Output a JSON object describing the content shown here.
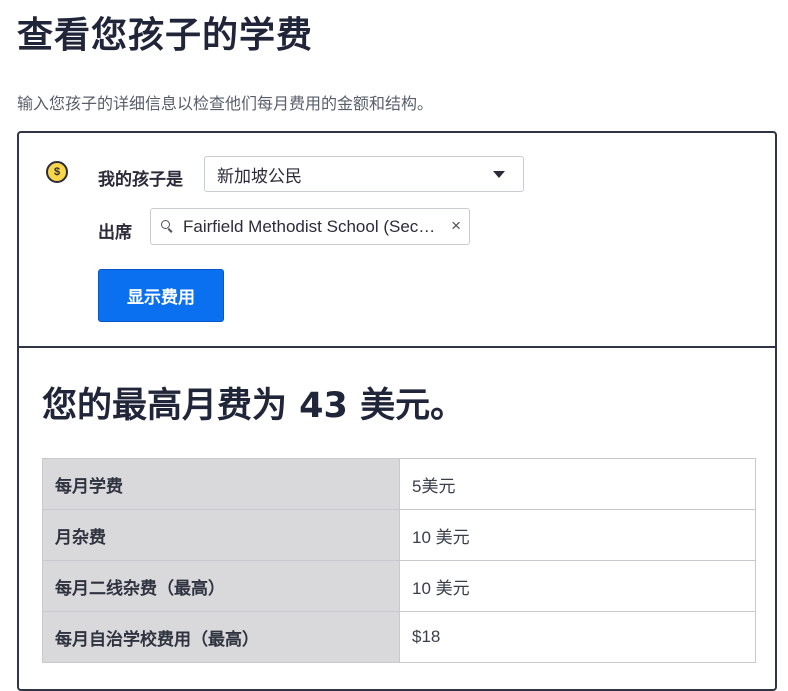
{
  "page": {
    "title": "查看您孩子的学费",
    "description": "输入您孩子的详细信息以检查他们每月费用的金额和结构。"
  },
  "form": {
    "coin_icon_symbol": "$",
    "child_label": "我的孩子是",
    "citizenship_selected": "新加坡公民",
    "attend_label": "出席",
    "school_value": "Fairfield Methodist School (Secondary)",
    "clear_symbol": "×",
    "show_button": "显示费用"
  },
  "result": {
    "heading": "您的最高月费为 43 美元。",
    "fees": [
      {
        "name": "每月学费",
        "value": "5美元"
      },
      {
        "name": "月杂费",
        "value": "10 美元"
      },
      {
        "name": "每月二线杂费（最高）",
        "value": "10 美元"
      },
      {
        "name": "每月自治学校费用（最高）",
        "value": "$18"
      }
    ]
  },
  "colors": {
    "primary_button": "#0a70f0",
    "card_border": "#2f3446",
    "coin": "#f7d64a"
  }
}
